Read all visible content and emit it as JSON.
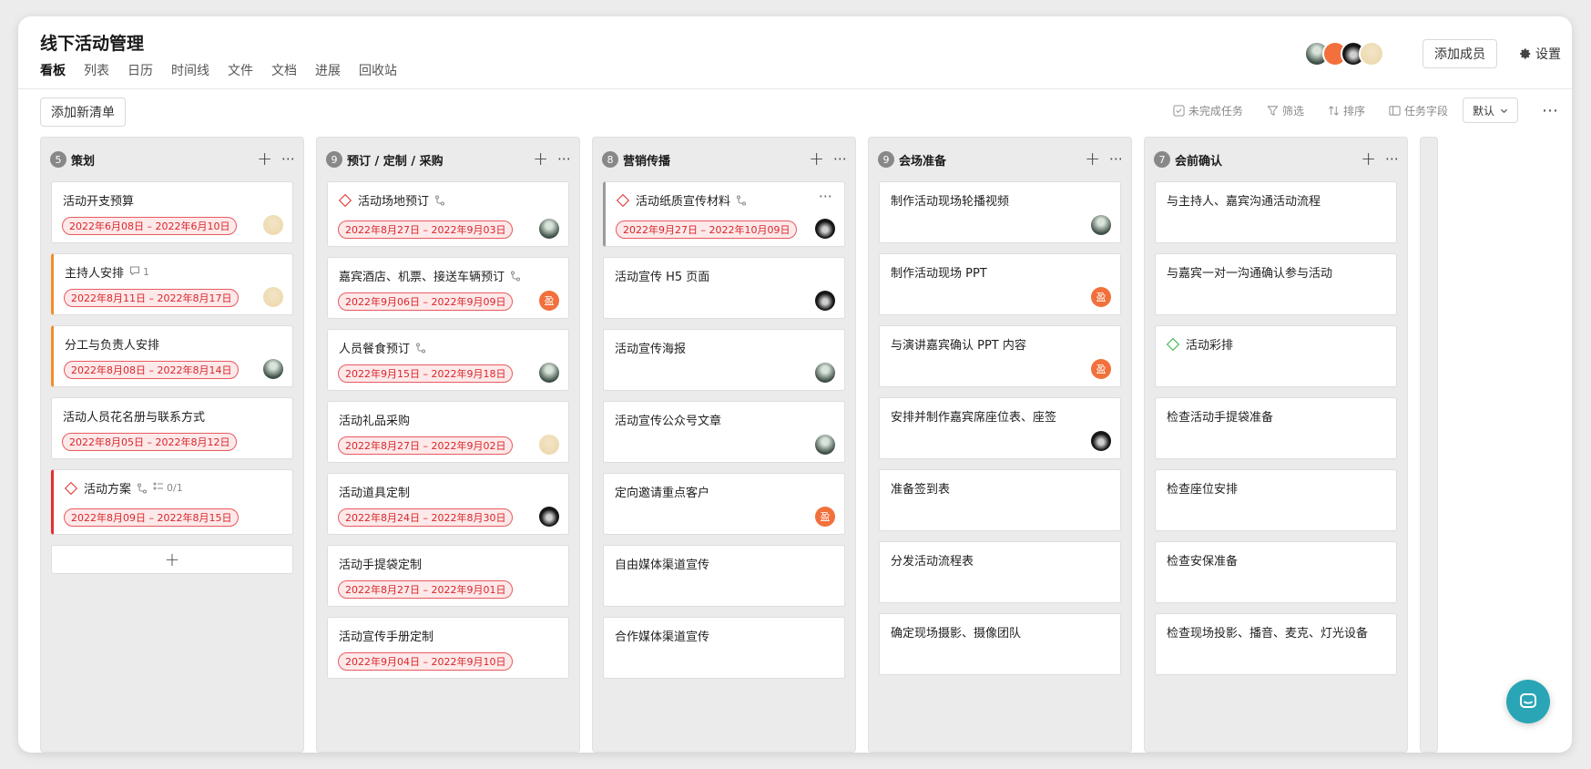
{
  "header": {
    "title": "线下活动管理",
    "tabs": [
      "看板",
      "列表",
      "日历",
      "时间线",
      "文件",
      "文档",
      "进展",
      "回收站"
    ],
    "add_member_label": "添加成员",
    "settings_label": "设置"
  },
  "toolbar": {
    "add_list_label": "添加新清单",
    "incomplete_label": "未完成任务",
    "filter_label": "筛选",
    "sort_label": "排序",
    "fields_label": "任务字段",
    "default_label": "默认"
  },
  "columns": [
    {
      "count": "5",
      "title": "策划",
      "cards": [
        {
          "title": "活动开支预算",
          "date": "2022年6月08日 – 2022年6月10日",
          "avatar": "light"
        },
        {
          "title": "主持人安排",
          "comments": "1",
          "date": "2022年8月11日 – 2022年8月17日",
          "avatar": "light",
          "bar": "orange"
        },
        {
          "title": "分工与负责人安排",
          "date": "2022年8月08日 – 2022年8月14日",
          "avatar": "green",
          "bar": "orange"
        },
        {
          "title": "活动人员花名册与联系方式",
          "date": "2022年8月05日 – 2022年8月12日"
        },
        {
          "title": "活动方案",
          "diamond": "red",
          "subtask": true,
          "checklist": "0/1",
          "date": "2022年8月09日 – 2022年8月15日",
          "bar": "red"
        }
      ]
    },
    {
      "count": "9",
      "title": "预订 / 定制 / 采购",
      "cards": [
        {
          "title": "活动场地预订",
          "diamond": "red",
          "subtask": true,
          "date": "2022年8月27日 – 2022年9月03日",
          "avatar": "green"
        },
        {
          "title": "嘉宾酒店、机票、接送车辆预订",
          "subtask": true,
          "date": "2022年9月06日 – 2022年9月09日",
          "avatar": "orange"
        },
        {
          "title": "人员餐食预订",
          "subtask": true,
          "date": "2022年9月15日 – 2022年9月18日",
          "avatar": "green"
        },
        {
          "title": "活动礼品采购",
          "date": "2022年8月27日 – 2022年9月02日",
          "avatar": "light"
        },
        {
          "title": "活动道具定制",
          "date": "2022年8月24日 – 2022年8月30日",
          "avatar": "dark"
        },
        {
          "title": "活动手提袋定制",
          "date": "2022年8月27日 – 2022年9月01日"
        },
        {
          "title": "活动宣传手册定制",
          "date": "2022年9月04日 – 2022年9月10日"
        }
      ]
    },
    {
      "count": "8",
      "title": "营销传播",
      "cards": [
        {
          "title": "活动纸质宣传材料",
          "diamond": "red",
          "subtask": true,
          "date": "2022年9月27日 – 2022年10月09日",
          "avatar": "dark",
          "bar": "gray",
          "more": true
        },
        {
          "title": "活动宣传 H5 页面",
          "avatar": "dark"
        },
        {
          "title": "活动宣传海报",
          "avatar": "green"
        },
        {
          "title": "活动宣传公众号文章",
          "avatar": "green"
        },
        {
          "title": "定向邀请重点客户",
          "avatar": "orange"
        },
        {
          "title": "自由媒体渠道宣传"
        },
        {
          "title": "合作媒体渠道宣传"
        }
      ]
    },
    {
      "count": "9",
      "title": "会场准备",
      "cards": [
        {
          "title": "制作活动现场轮播视频",
          "avatar": "green"
        },
        {
          "title": "制作活动现场 PPT",
          "avatar": "orange"
        },
        {
          "title": "与演讲嘉宾确认 PPT 内容",
          "avatar": "orange"
        },
        {
          "title": "安排并制作嘉宾席座位表、座签",
          "avatar": "dark"
        },
        {
          "title": "准备签到表"
        },
        {
          "title": "分发活动流程表"
        },
        {
          "title": "确定现场摄影、摄像团队"
        }
      ]
    },
    {
      "count": "7",
      "title": "会前确认",
      "cards": [
        {
          "title": "与主持人、嘉宾沟通活动流程"
        },
        {
          "title": "与嘉宾一对一沟通确认参与活动"
        },
        {
          "title": "活动彩排",
          "diamond": "green"
        },
        {
          "title": "检查活动手提袋准备"
        },
        {
          "title": "检查座位安排"
        },
        {
          "title": "检查安保准备"
        },
        {
          "title": "检查现场投影、播音、麦克、灯光设备"
        }
      ]
    }
  ],
  "avatar_glyph": "盈",
  "colors": {
    "date_text": "#d9252b",
    "bar_orange": "#f08c2e",
    "bar_red": "#e03131",
    "fab": "#2aa5b5"
  }
}
